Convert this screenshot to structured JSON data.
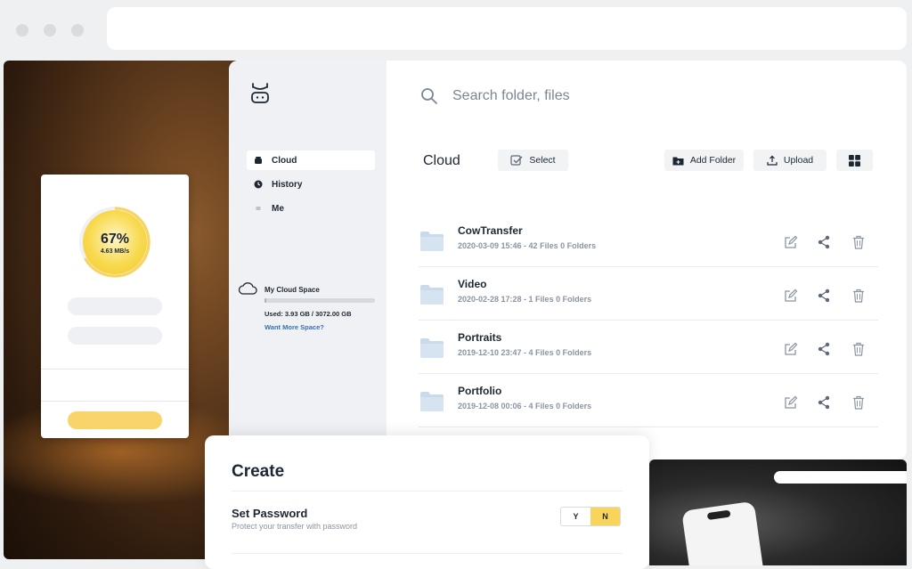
{
  "speed_card": {
    "progress_percent": 67,
    "progress_label": "67%",
    "speed": "4.63 MB/s"
  },
  "sidebar": {
    "items": [
      {
        "label": "Cloud",
        "icon": "cloud-drive-icon",
        "active": true
      },
      {
        "label": "History",
        "icon": "history-icon",
        "active": false
      },
      {
        "label": "Me",
        "icon": "menu-lines-icon",
        "active": false
      }
    ],
    "cloud_space": {
      "title": "My Cloud Space",
      "used_text": "Used: 3.93 GB / 3072.00 GB",
      "used_gb": 3.93,
      "total_gb": 3072.0,
      "more_link": "Want More Space?"
    }
  },
  "search": {
    "placeholder": "Search folder, files"
  },
  "toolbar": {
    "title": "Cloud",
    "select_label": "Select",
    "add_folder_label": "Add Folder",
    "upload_label": "Upload"
  },
  "files": [
    {
      "name": "CowTransfer",
      "meta": "2020-03-09 15:46   - 42 Files 0 Folders"
    },
    {
      "name": "Video",
      "meta": "2020-02-28 17:28   - 1 Files 0 Folders"
    },
    {
      "name": "Portraits",
      "meta": "2019-12-10 23:47   - 4 Files 0 Folders"
    },
    {
      "name": "Portfolio",
      "meta": "2019-12-08 00:06   - 4 Files 0 Folders"
    }
  ],
  "create_panel": {
    "title": "Create",
    "password_label": "Set Password",
    "password_hint": "Protect your transfer with password",
    "toggle_yes": "Y",
    "toggle_no": "N",
    "selected": "N"
  },
  "colors": {
    "accent_yellow": "#f9d45b",
    "sidebar_bg": "#eff1f4",
    "link_blue": "#3b6fb5",
    "folder_blue": "#c9daec"
  }
}
